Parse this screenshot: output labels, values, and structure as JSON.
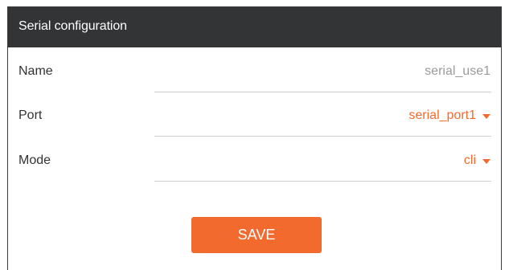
{
  "header": {
    "title": "Serial configuration"
  },
  "fields": {
    "name": {
      "label": "Name",
      "value": "serial_use1"
    },
    "port": {
      "label": "Port",
      "value": "serial_port1"
    },
    "mode": {
      "label": "Mode",
      "value": "cli"
    }
  },
  "actions": {
    "save_label": "SAVE"
  },
  "colors": {
    "accent": "#f26a2e",
    "header_bg": "#333436",
    "readonly_text": "#9a9a9a"
  },
  "icons": {
    "dropdown": "caret-down-icon"
  }
}
